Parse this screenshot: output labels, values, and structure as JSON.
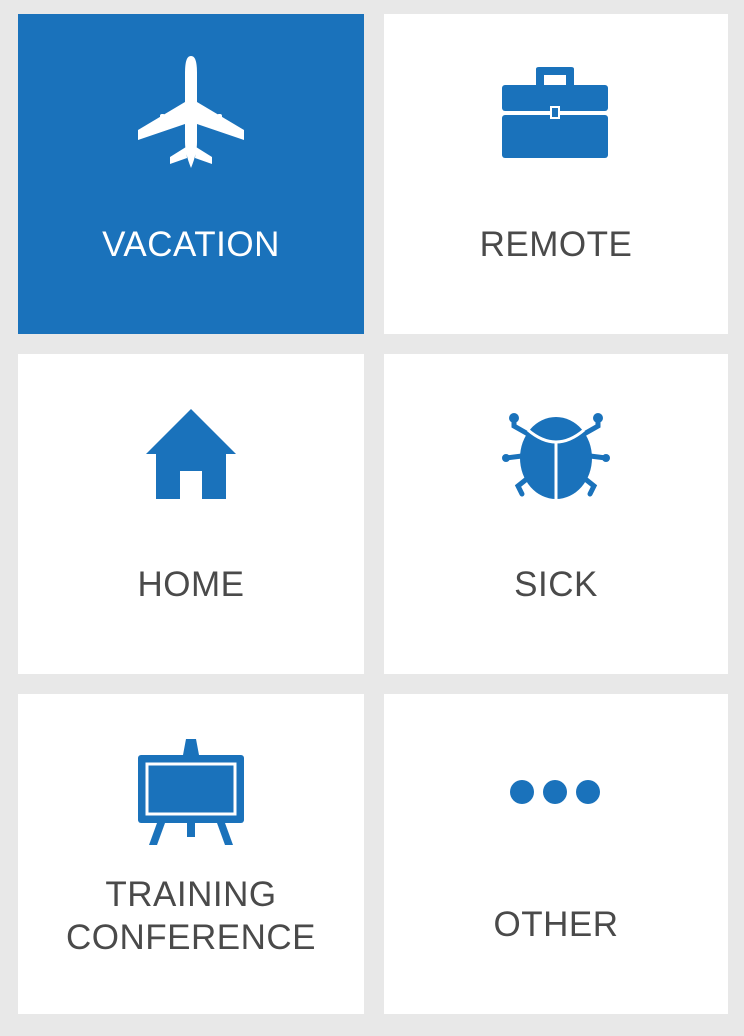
{
  "colors": {
    "accent": "#1a72bb",
    "tile_background": "#ffffff",
    "page_background": "#e8e8e8",
    "label_text": "#4a4a4a",
    "selected_label_text": "#ffffff"
  },
  "tiles": [
    {
      "id": "vacation",
      "label": "VACATION",
      "icon": "airplane-icon",
      "selected": true
    },
    {
      "id": "remote",
      "label": "REMOTE",
      "icon": "briefcase-icon",
      "selected": false
    },
    {
      "id": "home",
      "label": "HOME",
      "icon": "house-icon",
      "selected": false
    },
    {
      "id": "sick",
      "label": "SICK",
      "icon": "bug-icon",
      "selected": false
    },
    {
      "id": "training",
      "label_lines": [
        "TRAINING",
        "CONFERENCE"
      ],
      "icon": "easel-board-icon",
      "selected": false
    },
    {
      "id": "other",
      "label": "OTHER",
      "icon": "more-dots-icon",
      "selected": false
    }
  ]
}
